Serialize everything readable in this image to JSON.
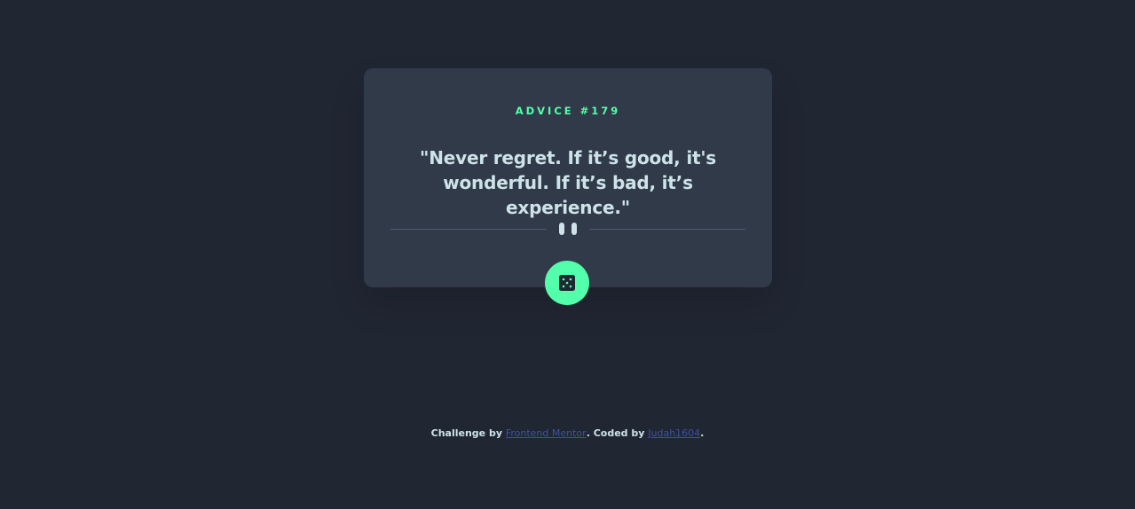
{
  "card": {
    "advice_label": "ADVICE #179",
    "quote": "\"Never regret. If it’s good, it's wonderful. If it’s bad, it’s experience.\""
  },
  "icons": {
    "divider": "pause-icon",
    "button": "dice-icon"
  },
  "footer": {
    "prefix": "Challenge by ",
    "challenge_link": "Frontend Mentor",
    "middle": ". Coded by ",
    "coder_link": "Judah1604",
    "suffix": "."
  },
  "colors": {
    "background": "#202632",
    "card": "#313a48",
    "accent": "#53ffaa",
    "text": "#cee3e9",
    "divider": "#4f5d74",
    "link": "#3e52a3"
  }
}
